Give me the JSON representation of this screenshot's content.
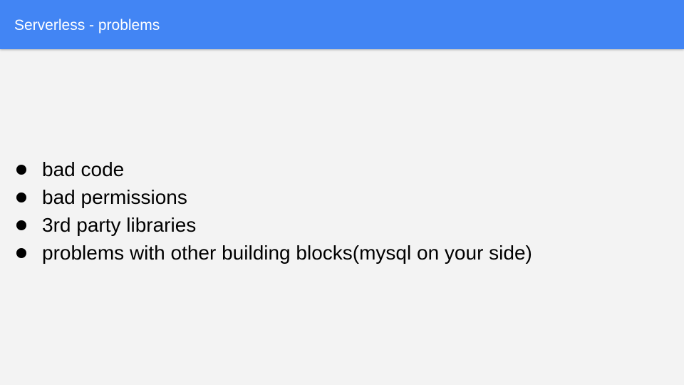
{
  "slide": {
    "title": "Serverless - problems",
    "bullets": [
      "bad code",
      "bad permissions",
      "3rd party libraries",
      "problems with other building blocks(mysql on your side)"
    ]
  },
  "colors": {
    "header_background": "#4285f4",
    "slide_background": "#f3f3f3",
    "title_text": "#ffffff",
    "body_text": "#000000"
  }
}
